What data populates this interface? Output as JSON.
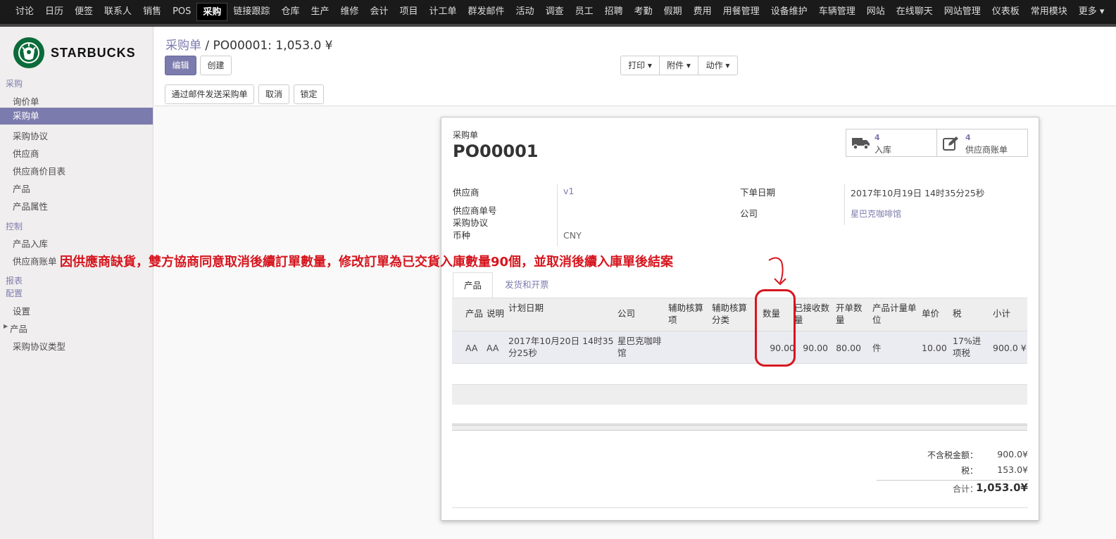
{
  "topnav": [
    "讨论",
    "日历",
    "便签",
    "联系人",
    "销售",
    "POS",
    "采购",
    "链接跟踪",
    "仓库",
    "生产",
    "维修",
    "会计",
    "项目",
    "计工单",
    "群发邮件",
    "活动",
    "调查",
    "员工",
    "招聘",
    "考勤",
    "假期",
    "费用",
    "用餐管理",
    "设备维护",
    "车辆管理",
    "网站",
    "在线聊天",
    "网站管理",
    "仪表板",
    "常用模块",
    "更多 ▾"
  ],
  "topnav_active": "采购",
  "logo_text": "STARBUCKS",
  "sidebar": {
    "sections": [
      {
        "title": "采购",
        "items": [
          "询价单",
          "采购单",
          "采购协议",
          "供应商",
          "供应商价目表",
          "产品",
          "产品属性"
        ]
      },
      {
        "title": "控制",
        "items": [
          "产品入库",
          "供应商账单"
        ]
      },
      {
        "title": "报表",
        "items": []
      },
      {
        "title": "配置",
        "items": [
          "设置",
          "产品",
          "采购协议类型"
        ]
      }
    ],
    "active": "采购单"
  },
  "breadcrumb": {
    "parent": "采购单",
    "sep": "/",
    "current": "PO00001: 1,053.0 ¥"
  },
  "buttons": {
    "edit": "编辑",
    "create": "创建",
    "print": "打印 ▾",
    "attach": "附件 ▾",
    "action": "动作 ▾"
  },
  "status_buttons": {
    "send_email": "通过邮件发送采购单",
    "cancel": "取消",
    "lock": "锁定"
  },
  "form": {
    "doc_type": "采购单",
    "name": "PO00001",
    "smart_buttons": [
      {
        "count": "4",
        "label": "入库"
      },
      {
        "count": "4",
        "label": "供应商账单"
      }
    ],
    "fields": {
      "vendor_label": "供应商",
      "vendor": "v1",
      "vendor_ref_label": "供应商单号",
      "agreement_label": "采购协议",
      "currency_label": "币种",
      "currency": "CNY",
      "order_date_label": "下单日期",
      "order_date": "2017年10月19日 14时35分25秒",
      "company_label": "公司",
      "company": "星巴克咖啡馆"
    },
    "tabs": [
      "产品",
      "发货和开票"
    ],
    "table": {
      "headers": [
        "产品",
        "说明",
        "计划日期",
        "公司",
        "辅助核算项",
        "辅助核算分类",
        "数量",
        "已接收数量",
        "开单数量",
        "产品计量单位",
        "单价",
        "税",
        "小计"
      ],
      "rows": [
        [
          "AA",
          "AA",
          "2017年10月20日 14时35分25秒",
          "星巴克咖啡馆",
          "",
          "",
          "90.00",
          "90.00",
          "80.00",
          "件",
          "10.00",
          "17%进项税",
          "900.0 ¥"
        ]
      ]
    },
    "totals": {
      "untaxed_label": "不含税金额：",
      "untaxed": "900.0¥",
      "tax_label": "税：",
      "tax": "153.0¥",
      "total_label": "合计：",
      "total": "1,053.0¥"
    }
  },
  "annotation": "因供應商缺貨，雙方協商同意取消後續訂單數量，修改訂單為已交貨入庫數量90個，並取消後續入庫單後結案",
  "colors": {
    "accent": "#7c7bad",
    "annotation": "#d6151e",
    "topbar": "#1a1a1a"
  }
}
